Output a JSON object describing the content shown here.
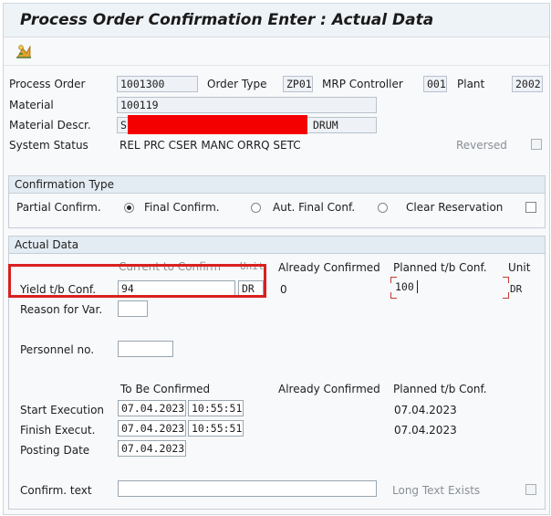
{
  "window": {
    "title": "Process Order Confirmation Enter : Actual Data"
  },
  "toolbar": {
    "icon": "goods-movement-icon"
  },
  "header": {
    "process_order_label": "Process Order",
    "process_order_value": "1001300",
    "order_type_label": "Order Type",
    "order_type_value": "ZP01",
    "mrp_controller_label": "MRP Controller",
    "mrp_controller_value": "001",
    "plant_label": "Plant",
    "plant_value": "2002",
    "material_label": "Material",
    "material_value": "100119",
    "material_descr_label": "Material Descr.",
    "material_descr_prefix": "S",
    "material_descr_suffix": "DRUM",
    "system_status_label": "System Status",
    "system_status_value": "REL  PRC  CSER MANC ORRQ SETC",
    "reversed_label": "Reversed"
  },
  "confirmation_type": {
    "title": "Confirmation Type",
    "partial_label": "Partial Confirm.",
    "final_label": "Final Confirm.",
    "aut_final_label": "Aut. Final Conf.",
    "clear_reservation_label": "Clear Reservation",
    "selected": "final"
  },
  "actual_data": {
    "title": "Actual Data",
    "col_current": "Current to Confirm",
    "col_unit": "Unit",
    "col_already": "Already Confirmed",
    "col_planned": "Planned t/b Conf.",
    "col_unit2": "Unit",
    "yield_label": "Yield t/b Conf.",
    "yield_value": "94",
    "yield_unit": "DR",
    "yield_already": "0",
    "yield_planned": "100",
    "yield_planned_unit": "DR",
    "reason_label": "Reason for Var.",
    "reason_value": "",
    "personnel_label": "Personnel no.",
    "personnel_value": "",
    "dates_col_tbc": "To Be Confirmed",
    "dates_col_already": "Already Confirmed",
    "dates_col_planned": "Planned t/b Conf.",
    "start_label": "Start Execution",
    "start_date": "07.04.2023",
    "start_time": "10:55:51",
    "start_planned": "07.04.2023",
    "finish_label": "Finish Execut.",
    "finish_date": "07.04.2023",
    "finish_time": "10:55:51",
    "finish_planned": "07.04.2023",
    "posting_label": "Posting Date",
    "posting_date": "07.04.2023",
    "confirm_text_label": "Confirm. text",
    "confirm_text_value": "",
    "long_text_label": "Long Text Exists"
  },
  "colors": {
    "highlight": "#d9201f",
    "redaction": "#f50000"
  }
}
